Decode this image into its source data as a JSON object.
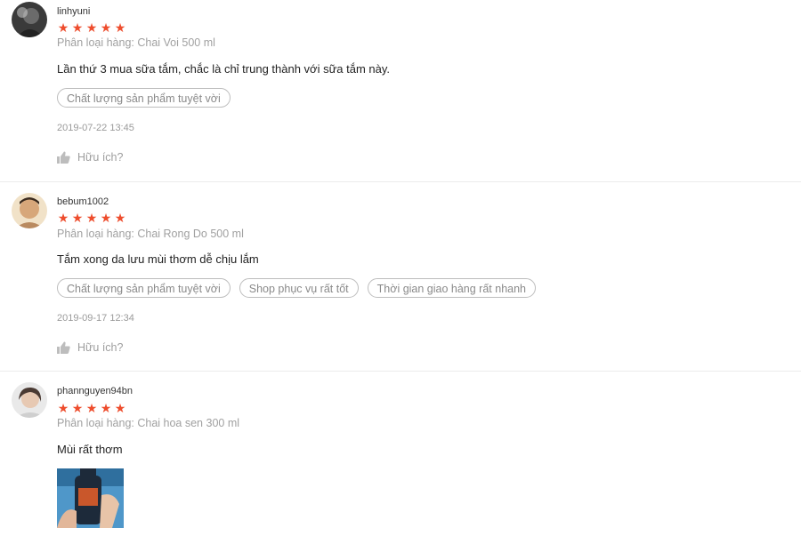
{
  "colors": {
    "star": "#ee4d2d",
    "muted": "#9e9e9e",
    "divider": "#ececec"
  },
  "reviews": [
    {
      "username": "linhyuni",
      "rating": 5,
      "variant": "Phân loại hàng: Chai Voi 500 ml",
      "comment": "Lần thứ 3 mua sữa tắm,  chắc là chỉ trung thành với sữa tắm này.",
      "tags": [
        "Chất lượng sản phẩm tuyệt vời"
      ],
      "timestamp": "2019-07-22 13:45",
      "helpful_label": "Hữu ích?"
    },
    {
      "username": "bebum1002",
      "rating": 5,
      "variant": "Phân loại hàng: Chai Rong Do 500 ml",
      "comment": "Tắm xong da lưu mùi thơm dễ chịu lắm",
      "tags": [
        "Chất lượng sản phẩm tuyệt vời",
        "Shop phục vụ rất tốt",
        "Thời gian giao hàng rất nhanh"
      ],
      "timestamp": "2019-09-17 12:34",
      "helpful_label": "Hữu ích?"
    },
    {
      "username": "phannguyen94bn",
      "rating": 5,
      "variant": "Phân loại hàng: Chai hoa sen 300 ml",
      "comment": "Mùi rất thơm",
      "tags": [],
      "has_photo": true
    }
  ]
}
